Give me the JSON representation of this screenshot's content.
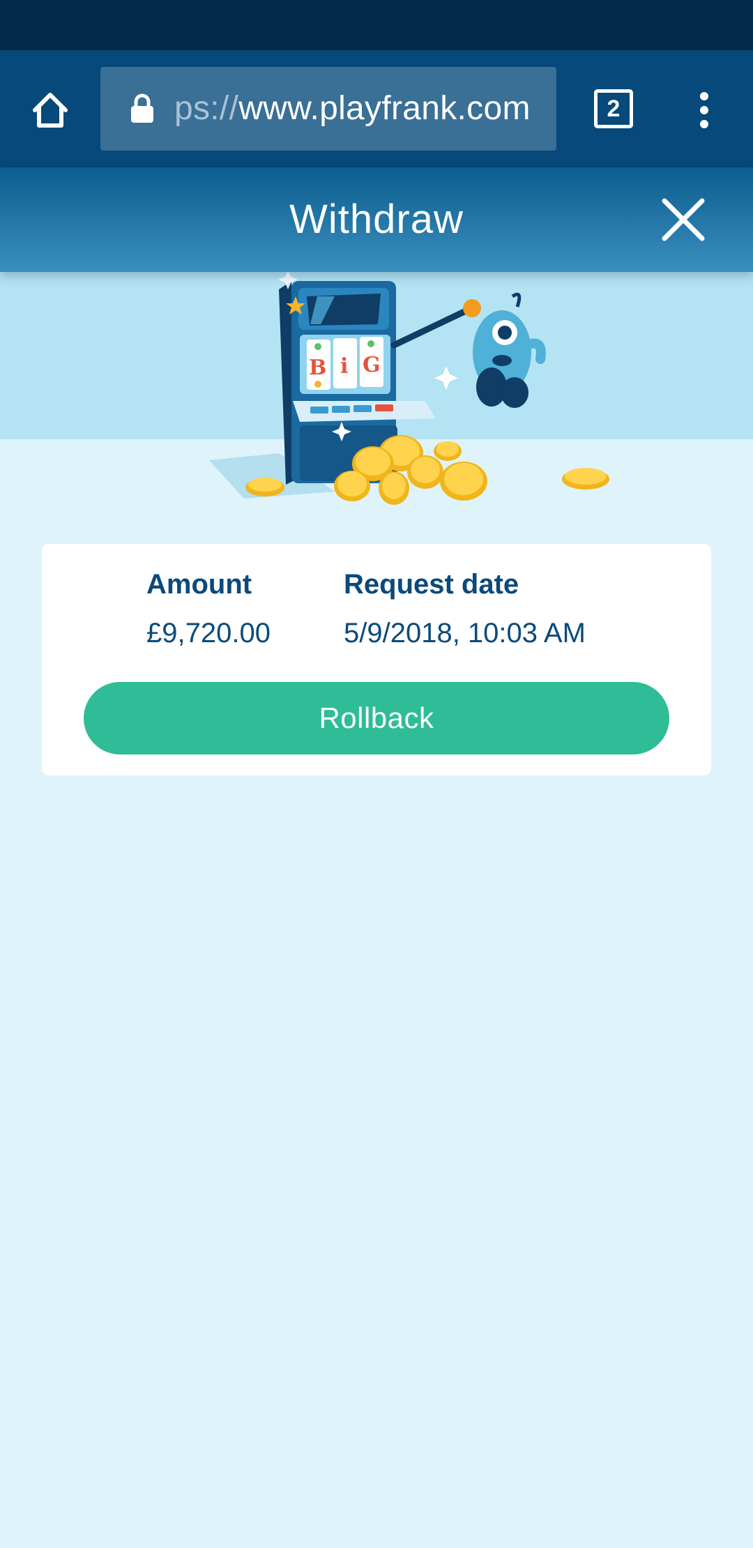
{
  "browser": {
    "url_prefix": "ps://",
    "url_host": "www.playfrank.com",
    "tab_count": "2",
    "icons": [
      "home-icon",
      "lock-icon",
      "tabs-icon",
      "more-vert-icon"
    ]
  },
  "header": {
    "title": "Withdraw",
    "close_icon": "close-icon"
  },
  "hero": {
    "illustration": "slot-machine-monster-coins",
    "reel_text": "BiG"
  },
  "withdrawal": {
    "amount_label": "Amount",
    "amount_value": "£9,720.00",
    "date_label": "Request date",
    "date_value": "5/9/2018, 10:03 AM",
    "rollback_label": "Rollback"
  },
  "colors": {
    "status_bar": "#022a48",
    "browser_bar": "#06497a",
    "header_gradient_top": "#0c5d8f",
    "header_gradient_bottom": "#3a8fbd",
    "page_background": "#dff3fa",
    "hero_background": "#b4e3f3",
    "text_primary": "#0b4a7a",
    "button_green": "#2ebd96"
  }
}
